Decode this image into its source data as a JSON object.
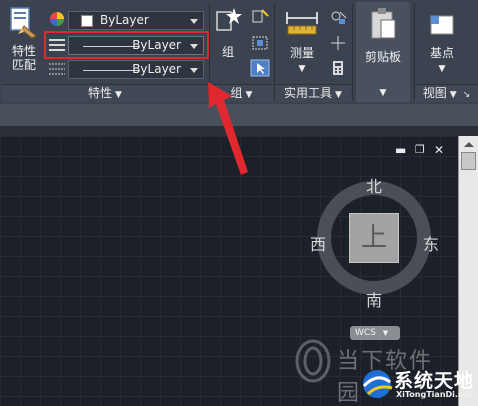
{
  "ribbon": {
    "properties_panel": {
      "match_properties_label": "特性\n匹配",
      "color_combo_value": "ByLayer",
      "linetype_combo_value": "ByLayer",
      "lineweight_combo_value": "ByLayer",
      "footer_label": "特性"
    },
    "groups_panel": {
      "group_label": "组",
      "footer_label": "组"
    },
    "utilities_panel": {
      "measure_label": "测量",
      "footer_label": "实用工具"
    },
    "clipboard_panel": {
      "paste_label": "剪贴板"
    },
    "view_panel": {
      "basepoint_label": "基点",
      "footer_label": "视图"
    }
  },
  "viewcube": {
    "north": "北",
    "south": "南",
    "east": "东",
    "west": "西",
    "face": "上",
    "wcs": "WCS"
  },
  "watermarks": {
    "brand1": "当下软件园",
    "brand2_cn": "系统天地",
    "brand2_en": "XiTongTianDi.net"
  },
  "colors": {
    "ribbon_bg": "#3b4250",
    "canvas_bg": "#1c2028",
    "highlight_box": "#e0282e",
    "annotation_arrow": "#e0282e"
  }
}
